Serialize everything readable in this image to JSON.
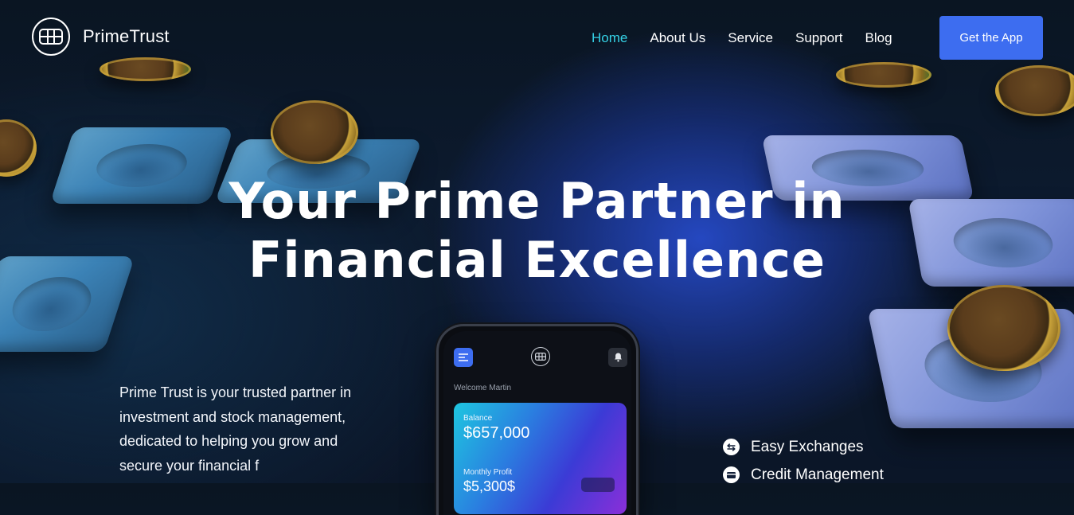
{
  "brand": {
    "name": "PrimeTrust",
    "logo_icon": "card-chip-icon"
  },
  "nav": {
    "items": [
      {
        "label": "Home",
        "active": true
      },
      {
        "label": "About Us",
        "active": false
      },
      {
        "label": "Service",
        "active": false
      },
      {
        "label": "Support",
        "active": false
      },
      {
        "label": "Blog",
        "active": false
      }
    ],
    "cta_label": "Get the App"
  },
  "hero": {
    "headline_line1": "Your Prime Partner in",
    "headline_line2": "Financial Excellence",
    "description": "Prime Trust is your trusted partner in investment and stock management, dedicated to helping you grow and secure your financial f",
    "features": [
      {
        "label": "Easy Exchanges",
        "icon": "exchange-arrows-icon"
      },
      {
        "label": "Credit Management",
        "icon": "credit-card-icon"
      }
    ]
  },
  "phone": {
    "welcome": "Welcome Martin",
    "balance_label": "Balance",
    "balance_value": "$657,000",
    "monthly_profit_label": "Monthly Profit",
    "monthly_profit_value": "$5,300$"
  },
  "colors": {
    "accent": "#3d6df0",
    "active_nav": "#35d1e6",
    "background": "#0b1628"
  }
}
